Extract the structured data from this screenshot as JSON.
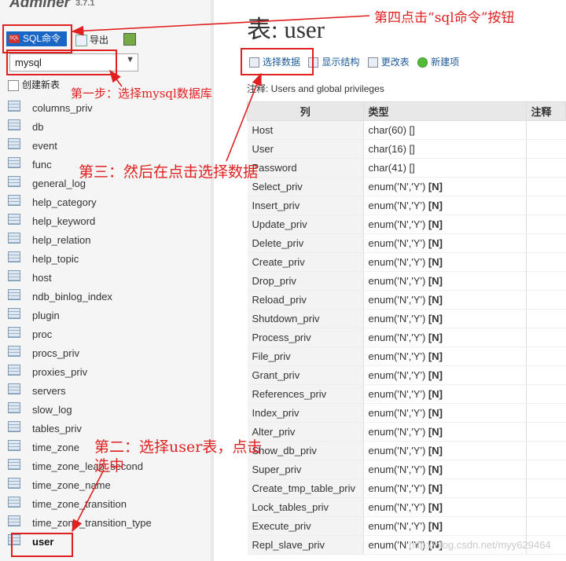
{
  "app": {
    "name": "Adminer",
    "version": "3.7.1"
  },
  "sidebar": {
    "sql_command": "SQL命令",
    "sql_icon_text": "SQL",
    "export": "导出",
    "db_select": "mysql",
    "create_table": "创建新表",
    "tables": [
      "columns_priv",
      "db",
      "event",
      "func",
      "general_log",
      "help_category",
      "help_keyword",
      "help_relation",
      "help_topic",
      "host",
      "ndb_binlog_index",
      "plugin",
      "proc",
      "procs_priv",
      "proxies_priv",
      "servers",
      "slow_log",
      "tables_priv",
      "time_zone",
      "time_zone_leap_second",
      "time_zone_name",
      "time_zone_transition",
      "time_zone_transition_type",
      "user"
    ],
    "active_table": "user"
  },
  "main": {
    "title": "表: user",
    "links": [
      "选择数据",
      "显示结构",
      "更改表",
      "新建项"
    ],
    "comment": "注释: Users and global privileges",
    "table": {
      "headers": [
        "列",
        "类型",
        "注释"
      ],
      "rows": [
        [
          "Host",
          "char(60) []"
        ],
        [
          "User",
          "char(16) []"
        ],
        [
          "Password",
          "char(41) []"
        ],
        [
          "Select_priv",
          "enum('N','Y') ",
          "[N]"
        ],
        [
          "Insert_priv",
          "enum('N','Y') ",
          "[N]"
        ],
        [
          "Update_priv",
          "enum('N','Y') ",
          "[N]"
        ],
        [
          "Delete_priv",
          "enum('N','Y') ",
          "[N]"
        ],
        [
          "Create_priv",
          "enum('N','Y') ",
          "[N]"
        ],
        [
          "Drop_priv",
          "enum('N','Y') ",
          "[N]"
        ],
        [
          "Reload_priv",
          "enum('N','Y') ",
          "[N]"
        ],
        [
          "Shutdown_priv",
          "enum('N','Y') ",
          "[N]"
        ],
        [
          "Process_priv",
          "enum('N','Y') ",
          "[N]"
        ],
        [
          "File_priv",
          "enum('N','Y') ",
          "[N]"
        ],
        [
          "Grant_priv",
          "enum('N','Y') ",
          "[N]"
        ],
        [
          "References_priv",
          "enum('N','Y') ",
          "[N]"
        ],
        [
          "Index_priv",
          "enum('N','Y') ",
          "[N]"
        ],
        [
          "Alter_priv",
          "enum('N','Y') ",
          "[N]"
        ],
        [
          "Show_db_priv",
          "enum('N','Y') ",
          "[N]"
        ],
        [
          "Super_priv",
          "enum('N','Y') ",
          "[N]"
        ],
        [
          "Create_tmp_table_priv",
          "enum('N','Y') ",
          "[N]"
        ],
        [
          "Lock_tables_priv",
          "enum('N','Y') ",
          "[N]"
        ],
        [
          "Execute_priv",
          "enum('N','Y') ",
          "[N]"
        ],
        [
          "Repl_slave_priv",
          "enum('N','Y') ",
          "[N]"
        ]
      ]
    }
  },
  "annotations": {
    "step1": "第一步：选择mysql数据库",
    "step2_line1": "第二：选择user表，点击",
    "step2_line2": "选中",
    "step3": "第三：然后在点击选择数据",
    "step4": "第四点击“sql命令”按钮",
    "color": "#e02020"
  },
  "watermark": "http://blog.csdn.net/myy629464"
}
